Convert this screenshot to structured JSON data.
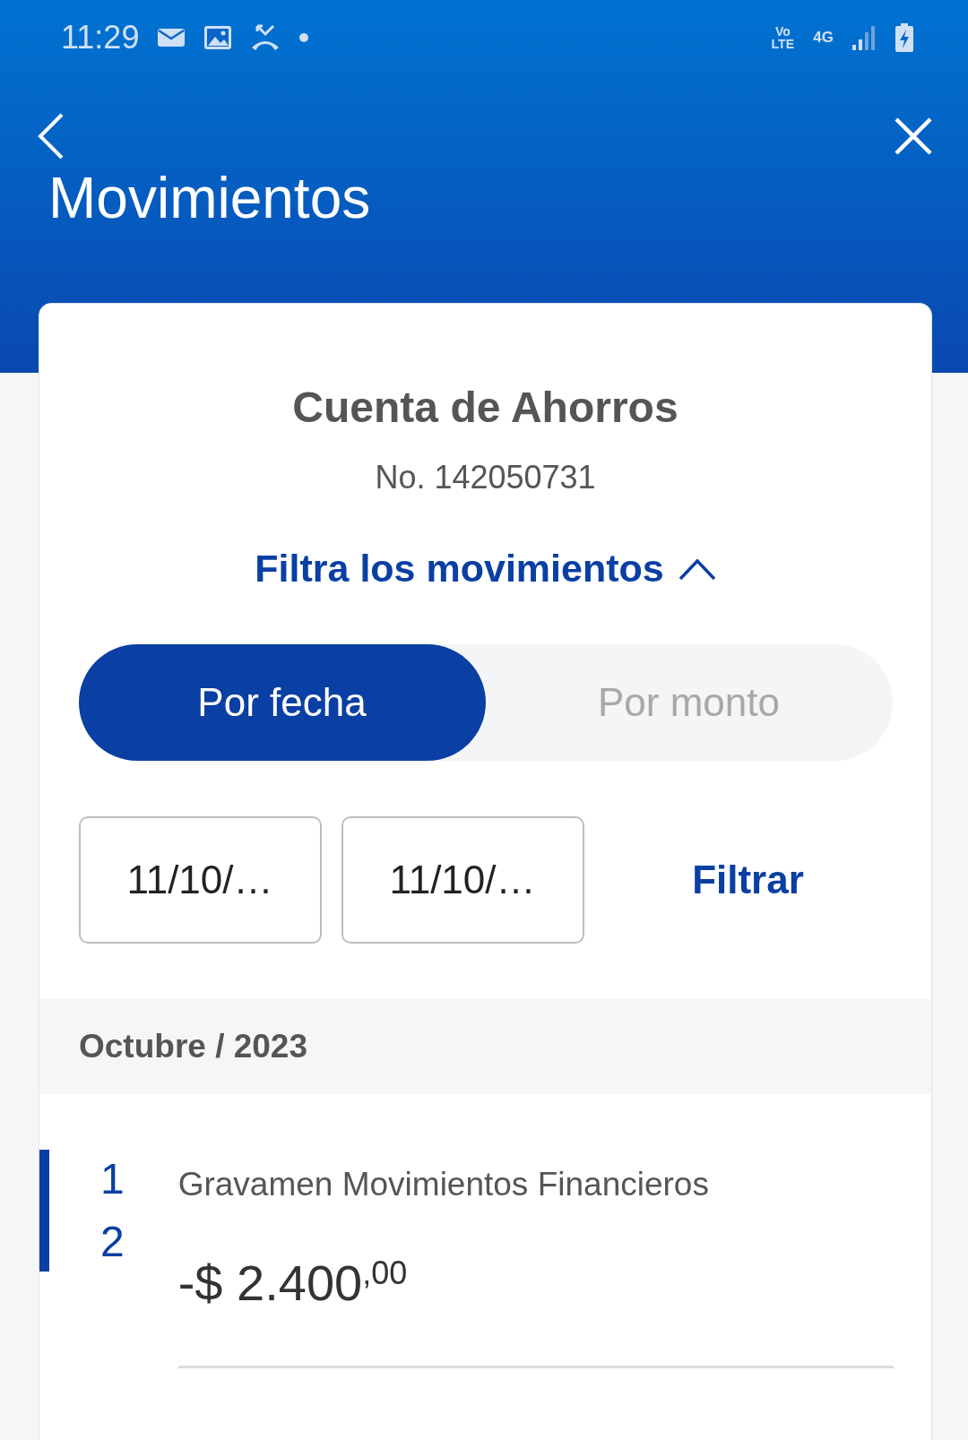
{
  "status_bar": {
    "time": "11:29",
    "volte": "Vo LTE",
    "network": "4G"
  },
  "header": {
    "title": "Movimientos"
  },
  "account": {
    "name": "Cuenta de Ahorros",
    "number": "No. 142050731"
  },
  "filter": {
    "label": "Filtra los movimientos",
    "expanded": true,
    "tabs": [
      {
        "label": "Por fecha",
        "selected": true
      },
      {
        "label": "Por monto",
        "selected": false
      }
    ],
    "date_fields": [
      {
        "value": "11/10/…"
      },
      {
        "value": "11/10/…"
      }
    ],
    "apply": "Filtrar"
  },
  "month": "Octubre / 2023",
  "movements": [
    {
      "day": "12",
      "description": "Gravamen Movimientos Financieros",
      "amount": "-$ 2.400$^{,00}$"
    }
  ]
}
